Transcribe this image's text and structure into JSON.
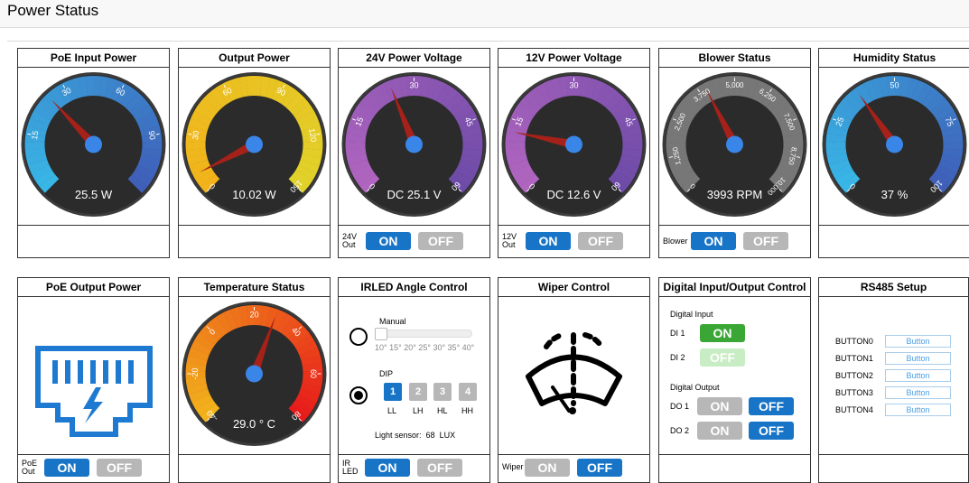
{
  "page": {
    "title": "Power Status"
  },
  "gauges": [
    {
      "id": "poe-input",
      "title": "PoE Input Power",
      "readout": "25.5 W",
      "min": 0,
      "max": 75,
      "value": 25.5,
      "ticks": [
        "15",
        "30",
        "60",
        "90"
      ],
      "tick_values": [
        15,
        30,
        45,
        60
      ],
      "color_from": "#38b6e6",
      "color_to": "#3f5fb8"
    },
    {
      "id": "output-power",
      "title": "Output Power",
      "readout": "10.02 W",
      "min": 0,
      "max": 150,
      "value": 10.02,
      "ticks": [
        "0",
        "30",
        "60",
        "90",
        "120",
        "150"
      ],
      "tick_values": [
        0,
        30,
        60,
        90,
        120,
        150
      ],
      "color_from": "#f2b31b",
      "color_to": "#e1d22a"
    },
    {
      "id": "v24",
      "title": "24V Power Voltage",
      "readout": "DC 25.1 V",
      "min": 0,
      "max": 60,
      "value": 25.1,
      "ticks": [
        "0",
        "15",
        "30",
        "45",
        "60"
      ],
      "tick_values": [
        0,
        15,
        30,
        45,
        60
      ],
      "color_from": "#b065c0",
      "color_to": "#6e4ba8"
    },
    {
      "id": "v12",
      "title": "12V Power Voltage",
      "readout": "DC 12.6 V",
      "min": 0,
      "max": 60,
      "value": 12.6,
      "ticks": [
        "0",
        "15",
        "30",
        "45",
        "60"
      ],
      "tick_values": [
        0,
        15,
        30,
        45,
        60
      ],
      "color_from": "#b065c0",
      "color_to": "#6e4ba8"
    },
    {
      "id": "blower",
      "title": "Blower Status",
      "readout": "3993 RPM",
      "min": 0,
      "max": 10000,
      "value": 3993,
      "ticks": [
        "0",
        "1,250",
        "2,500",
        "3,750",
        "5,000",
        "6,250",
        "7,500",
        "8,750",
        "10,000"
      ],
      "tick_values": [
        0,
        1250,
        2500,
        3750,
        5000,
        6250,
        7500,
        8750,
        10000
      ],
      "color_from": "#777777",
      "color_to": "#777777"
    },
    {
      "id": "humidity",
      "title": "Humidity Status",
      "readout": "37 %",
      "min": 0,
      "max": 100,
      "value": 37,
      "ticks": [
        "0",
        "25",
        "50",
        "75",
        "100"
      ],
      "tick_values": [
        0,
        25,
        50,
        75,
        100
      ],
      "color_from": "#38b6e6",
      "color_to": "#3f5fb8"
    },
    {
      "id": "temperature",
      "title": "Temperature Status",
      "readout": "29.0 ° C",
      "min": -40,
      "max": 80,
      "value": 29,
      "ticks": [
        "-40",
        "-20",
        "0",
        "20",
        "40",
        "60",
        "80"
      ],
      "tick_values": [
        -40,
        -20,
        0,
        20,
        40,
        60,
        80
      ],
      "color_from": "#f2b31b",
      "color_to": "#e81b1b"
    }
  ],
  "switches": {
    "v24": {
      "label_line1": "24V",
      "label_line2": "Out",
      "on": "ON",
      "off": "OFF"
    },
    "v12": {
      "label_line1": "12V",
      "label_line2": "Out",
      "on": "ON",
      "off": "OFF"
    },
    "blower": {
      "label": "Blower",
      "on": "ON",
      "off": "OFF"
    },
    "poe": {
      "label_line1": "PoE",
      "label_line2": "Out",
      "on": "ON",
      "off": "OFF"
    },
    "irled": {
      "label_line1": "IR",
      "label_line2": "LED",
      "on": "ON",
      "off": "OFF"
    },
    "wiper": {
      "label": "Wiper",
      "on": "ON",
      "off": "OFF"
    }
  },
  "panels": {
    "poe_output": "PoE Output Power",
    "irled": "IRLED Angle Control",
    "wiper": "Wiper Control",
    "dio": "Digital Input/Output Control",
    "rs485": "RS485 Setup"
  },
  "irled": {
    "manual_label": "Manual",
    "angle_scale": "10° 15° 20° 25° 30° 35° 40°",
    "dip_label": "DIP",
    "dip_values": [
      "1",
      "2",
      "3",
      "4"
    ],
    "dip_names": [
      "LL",
      "LH",
      "HL",
      "HH"
    ],
    "light_sensor_label": "Light sensor:",
    "light_sensor_value": "68",
    "light_sensor_unit": "LUX"
  },
  "dio": {
    "input_title": "Digital Input",
    "di1": "DI 1",
    "di1_state": "ON",
    "di2": "DI 2",
    "di2_state": "OFF",
    "output_title": "Digital Output",
    "do1": "DO 1",
    "do2": "DO 2",
    "on": "ON",
    "off": "OFF"
  },
  "rs485": {
    "buttons": [
      {
        "label": "BUTTON0",
        "value": "Button"
      },
      {
        "label": "BUTTON1",
        "value": "Button"
      },
      {
        "label": "BUTTON2",
        "value": "Button"
      },
      {
        "label": "BUTTON3",
        "value": "Button"
      },
      {
        "label": "BUTTON4",
        "value": "Button"
      }
    ]
  },
  "colors": {
    "accent": "#1774c6",
    "off": "#b7b7b7",
    "di_on": "#3aa635",
    "di_off": "#c8edc4",
    "needle": "#a52119",
    "hub": "#3a86e8"
  }
}
